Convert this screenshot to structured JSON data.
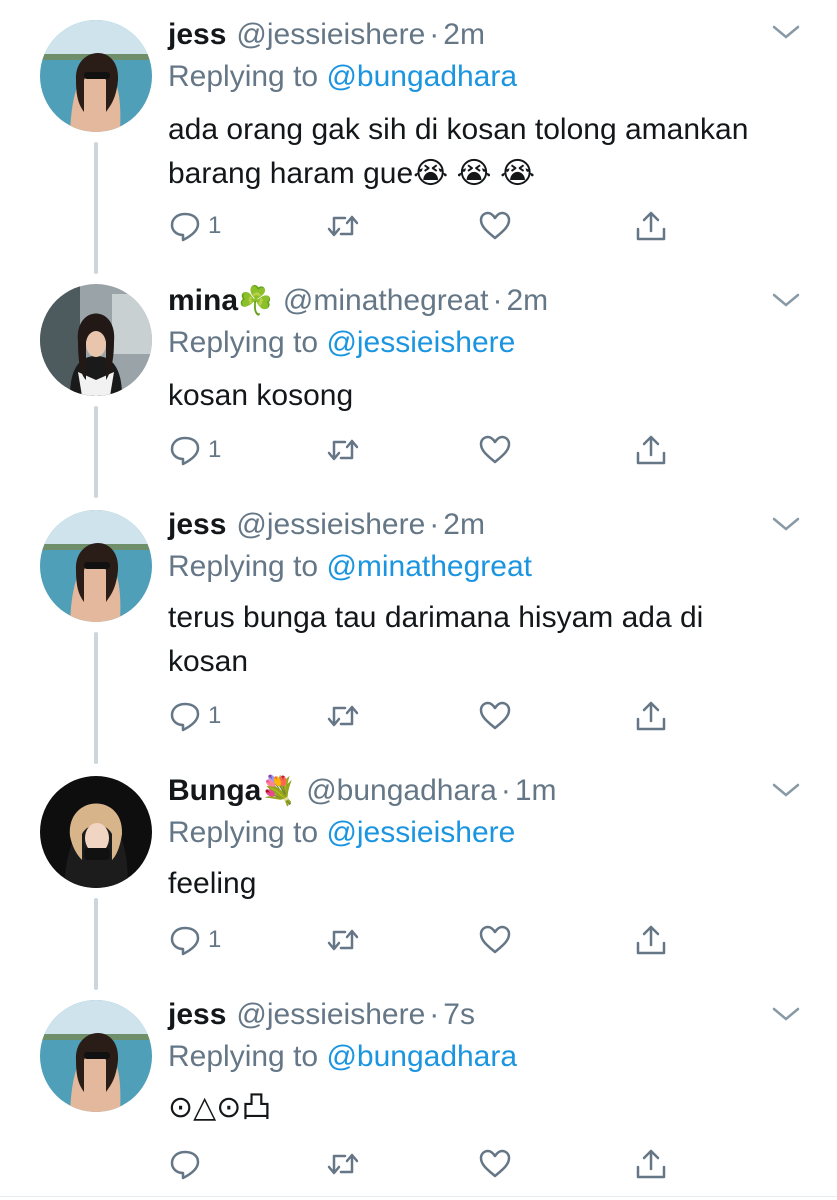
{
  "tweets": [
    {
      "name": "jess",
      "name_emoji": "",
      "handle": "@jessieishere",
      "time": "2m",
      "replying_prefix": "Replying to",
      "replying_to": "@bungadhara",
      "text": "ada orang gak sih di kosan tolong amankan barang haram gue😭 😭 😭",
      "reply_count": "1"
    },
    {
      "name": "mina",
      "name_emoji": "☘️",
      "handle": "@minathegreat",
      "time": "2m",
      "replying_prefix": "Replying to",
      "replying_to": "@jessieishere",
      "text": "kosan kosong",
      "reply_count": "1"
    },
    {
      "name": "jess",
      "name_emoji": "",
      "handle": "@jessieishere",
      "time": "2m",
      "replying_prefix": "Replying to",
      "replying_to": "@minathegreat",
      "text": "terus bunga tau darimana hisyam ada di kosan",
      "reply_count": "1"
    },
    {
      "name": "Bunga",
      "name_emoji": "💐",
      "handle": "@bungadhara",
      "time": "1m",
      "replying_prefix": "Replying to",
      "replying_to": "@jessieishere",
      "text": "feeling",
      "reply_count": "1"
    },
    {
      "name": "jess",
      "name_emoji": "",
      "handle": "@jessieishere",
      "time": "7s",
      "replying_prefix": "Replying to",
      "replying_to": "@bungadhara",
      "text": "⊙△⊙凸",
      "reply_count": ""
    }
  ],
  "icons": {
    "reply": "reply-icon",
    "retweet": "retweet-icon",
    "like": "heart-icon",
    "share": "share-icon",
    "menu": "chevron-down-icon"
  },
  "colors": {
    "text": "#14171a",
    "secondary": "#657786",
    "link": "#1b95e0",
    "thread_line": "#ccd6dd"
  }
}
